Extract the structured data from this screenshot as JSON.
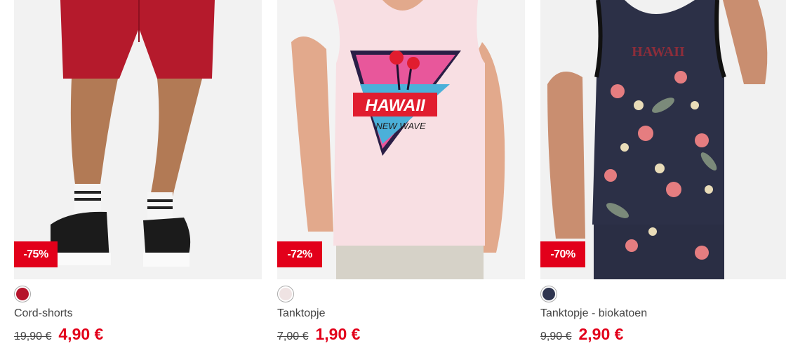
{
  "products": [
    {
      "name": "Cord-shorts",
      "discount": "-75%",
      "old_price": "19,90 €",
      "new_price": "4,90 €",
      "swatch_color": "#b5142b"
    },
    {
      "name": "Tanktopje",
      "discount": "-72%",
      "old_price": "7,00 €",
      "new_price": "1,90 €",
      "swatch_color": "#efe3e3"
    },
    {
      "name": "Tanktopje - biokatoen",
      "discount": "-70%",
      "old_price": "9,90 €",
      "new_price": "2,90 €",
      "swatch_color": "#2f3550"
    }
  ],
  "colors": {
    "sale_red": "#e2001a"
  }
}
